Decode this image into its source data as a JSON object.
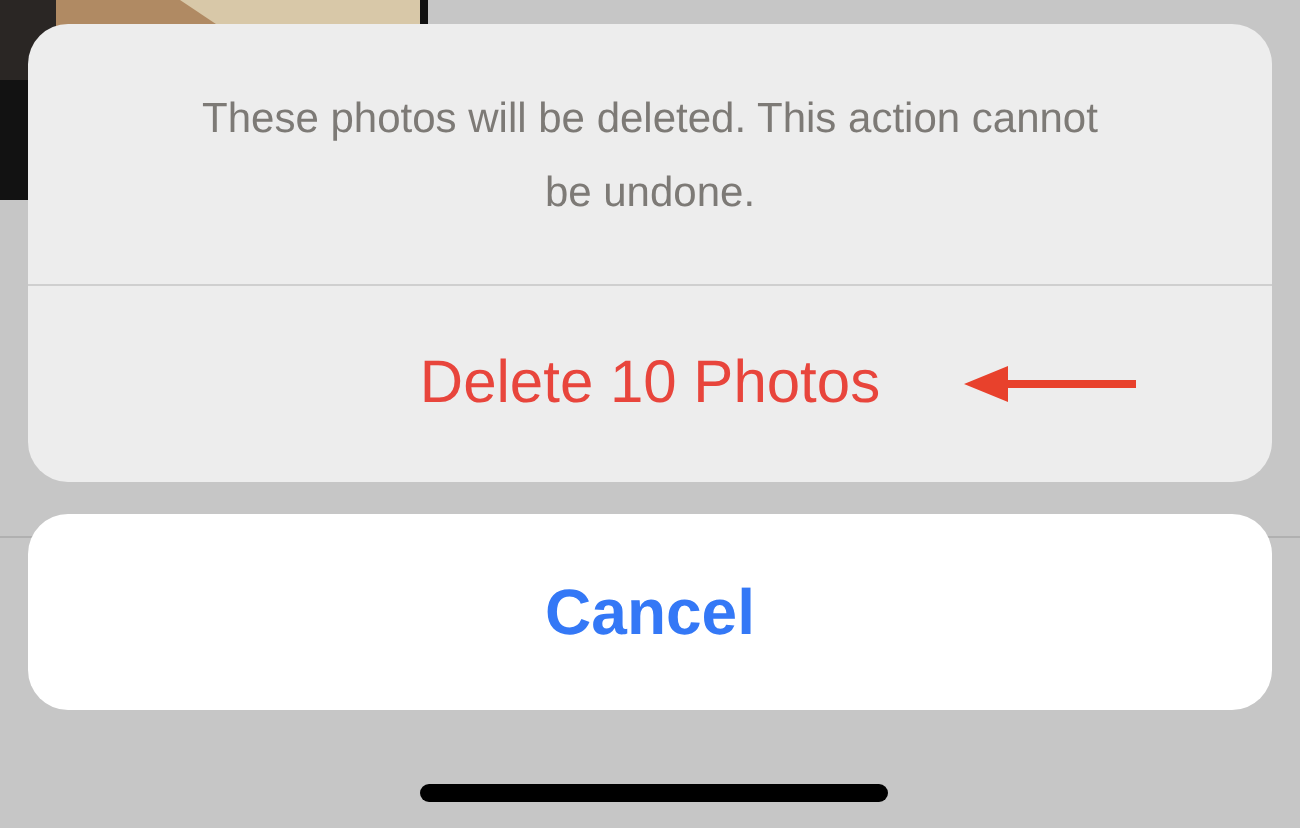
{
  "action_sheet": {
    "message": "These photos will be deleted. This action cannot be undone.",
    "actions": [
      {
        "label": "Delete 10 Photos",
        "kind": "destructive"
      }
    ]
  },
  "cancel_button": {
    "label": "Cancel"
  },
  "annotation": {
    "kind": "arrow"
  }
}
